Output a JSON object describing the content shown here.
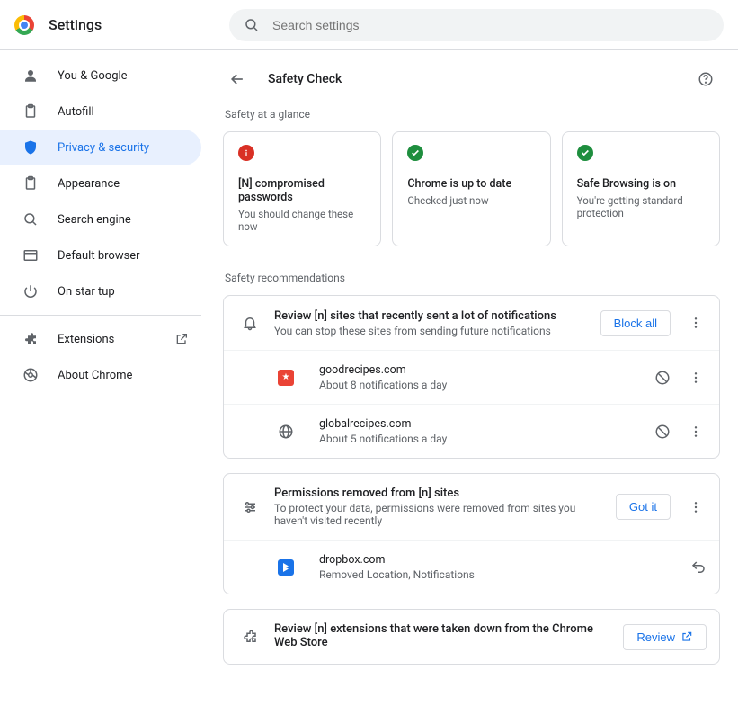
{
  "header": {
    "title": "Settings",
    "search_placeholder": "Search settings"
  },
  "page": {
    "title": "Safety Check"
  },
  "sidebar": {
    "items": [
      {
        "label": "You & Google"
      },
      {
        "label": "Autofill"
      },
      {
        "label": "Privacy & security"
      },
      {
        "label": "Appearance"
      },
      {
        "label": "Search engine"
      },
      {
        "label": "Default browser"
      },
      {
        "label": "On star  tup"
      },
      {
        "label": "Extensions"
      },
      {
        "label": "About Chrome"
      }
    ]
  },
  "glance": {
    "label": "Safety at a glance",
    "cards": [
      {
        "title": "[N] compromised passwords",
        "sub": "You should change these now"
      },
      {
        "title": "Chrome is up to date",
        "sub": "Checked just now"
      },
      {
        "title": "Safe Browsing is on",
        "sub": "You're getting standard protection"
      }
    ]
  },
  "recs": {
    "label": "Safety recommendations",
    "notif": {
      "title": "Review [n] sites that recently sent a lot of notifications",
      "sub": "You can stop these sites from sending future notifications",
      "button": "Block all",
      "sites": [
        {
          "name": "goodrecipes.com",
          "sub": "About 8 notifications a day"
        },
        {
          "name": "globalrecipes.com",
          "sub": "About 5 notifications a day"
        }
      ]
    },
    "perm": {
      "title": "Permissions removed from [n] sites",
      "sub": "To protect your data, permissions were removed from sites you haven't visited recently",
      "button": "Got it",
      "sites": [
        {
          "name": "dropbox.com",
          "sub": "Removed Location, Notifications"
        }
      ]
    },
    "ext": {
      "title": "Review [n] extensions that were taken down from the Chrome Web Store",
      "button": "Review"
    }
  }
}
